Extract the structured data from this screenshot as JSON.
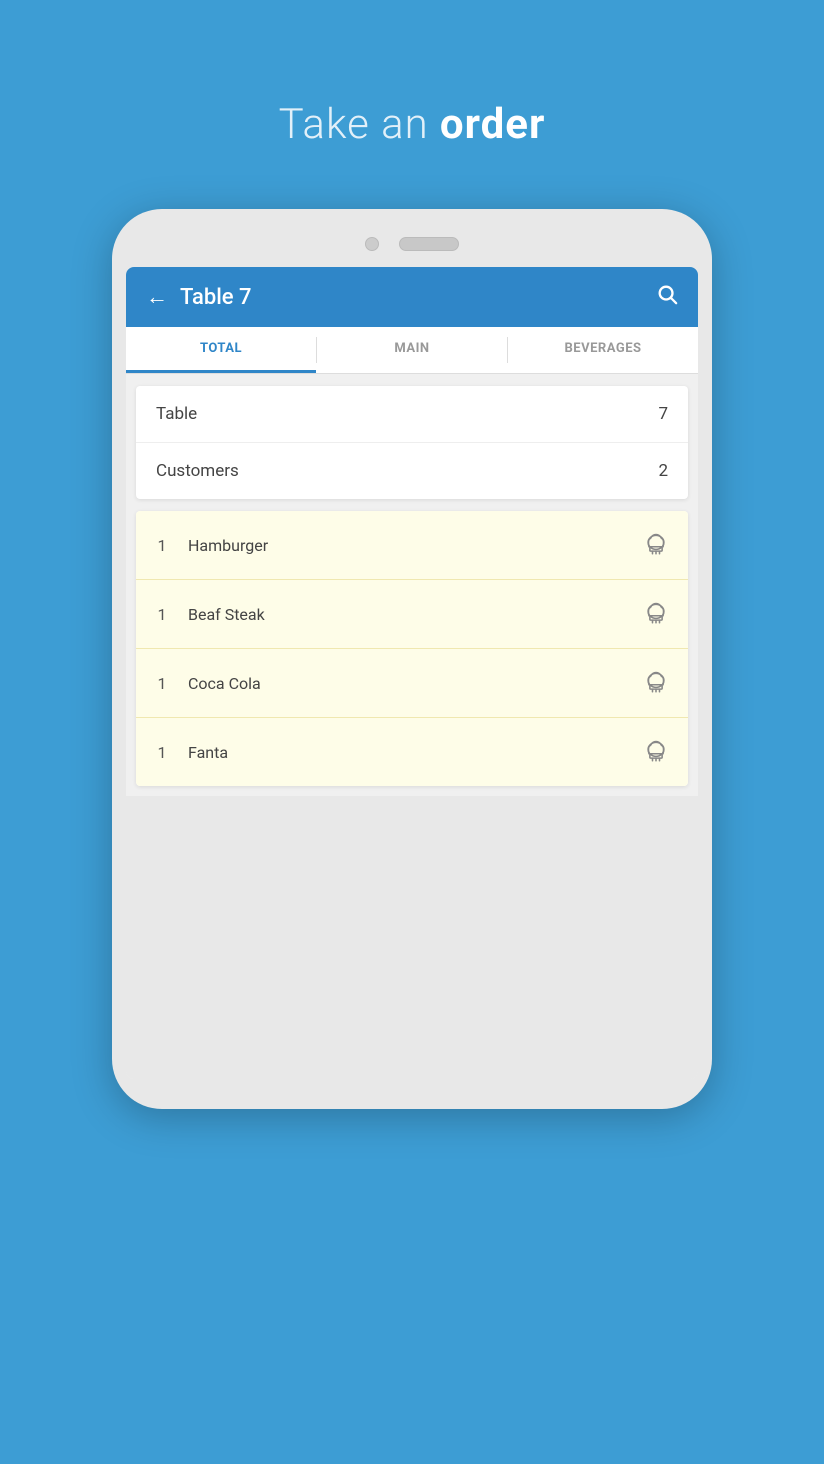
{
  "header": {
    "title_prefix": "Take an ",
    "title_bold": "order"
  },
  "app_bar": {
    "back_label": "←",
    "title": "Table 7",
    "search_icon": "🔍"
  },
  "tabs": [
    {
      "id": "total",
      "label": "TOTAL",
      "active": true
    },
    {
      "id": "main",
      "label": "MAIN",
      "active": false
    },
    {
      "id": "beverages",
      "label": "BEVERAGES",
      "active": false
    }
  ],
  "info_rows": [
    {
      "label": "Table",
      "value": "7"
    },
    {
      "label": "Customers",
      "value": "2"
    }
  ],
  "order_items": [
    {
      "qty": "1",
      "name": "Hamburger"
    },
    {
      "qty": "1",
      "name": "Beaf Steak"
    },
    {
      "qty": "1",
      "name": "Coca Cola"
    },
    {
      "qty": "1",
      "name": "Fanta"
    }
  ],
  "colors": {
    "background": "#3d9dd4",
    "app_bar": "#2f86c8",
    "tab_active": "#2f86c8",
    "order_item_bg": "#fefde8",
    "order_item_border": "#f0e8b0"
  }
}
